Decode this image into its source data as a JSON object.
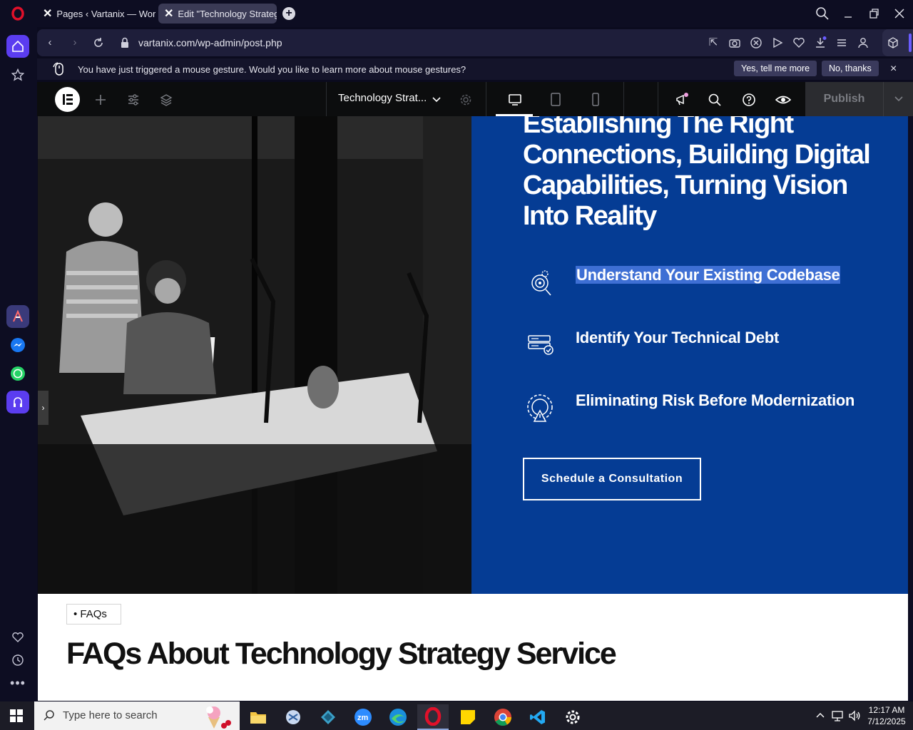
{
  "browser": {
    "tabs": [
      {
        "label": "Pages ‹ Vartanix — WordP"
      },
      {
        "label": "Edit \"Technology Strategy"
      }
    ],
    "url": "vartanix.com/wp-admin/post.php"
  },
  "notification": {
    "message": "You have just triggered a mouse gesture. Would you like to learn more about mouse gestures?",
    "yes_label": "Yes, tell me more",
    "no_label": "No, thanks",
    "close": "×"
  },
  "editor": {
    "page_title": "Technology Strat...",
    "publish_label": "Publish"
  },
  "hero": {
    "headline": "Establishing The Right Connections, Building Digital Capabilities, Turning Vision Into Reality",
    "features": [
      {
        "label": "Understand Your Existing Codebase",
        "icon": "target-gears-icon"
      },
      {
        "label": "Identify Your Technical Debt",
        "icon": "server-check-icon"
      },
      {
        "label": "Eliminating Risk Before Modernization",
        "icon": "gear-warning-icon"
      }
    ],
    "cta_label": "Schedule a Consultation"
  },
  "faq": {
    "pill_label": "FAQs",
    "heading": "FAQs About Technology Strategy Service"
  },
  "taskbar": {
    "search_placeholder": "Type here to search",
    "time": "12:17 AM",
    "date": "7/12/2025"
  },
  "colors": {
    "panel_blue": "#053c94",
    "highlight_blue": "#3e6fd4",
    "opera_red": "#e0102a"
  }
}
